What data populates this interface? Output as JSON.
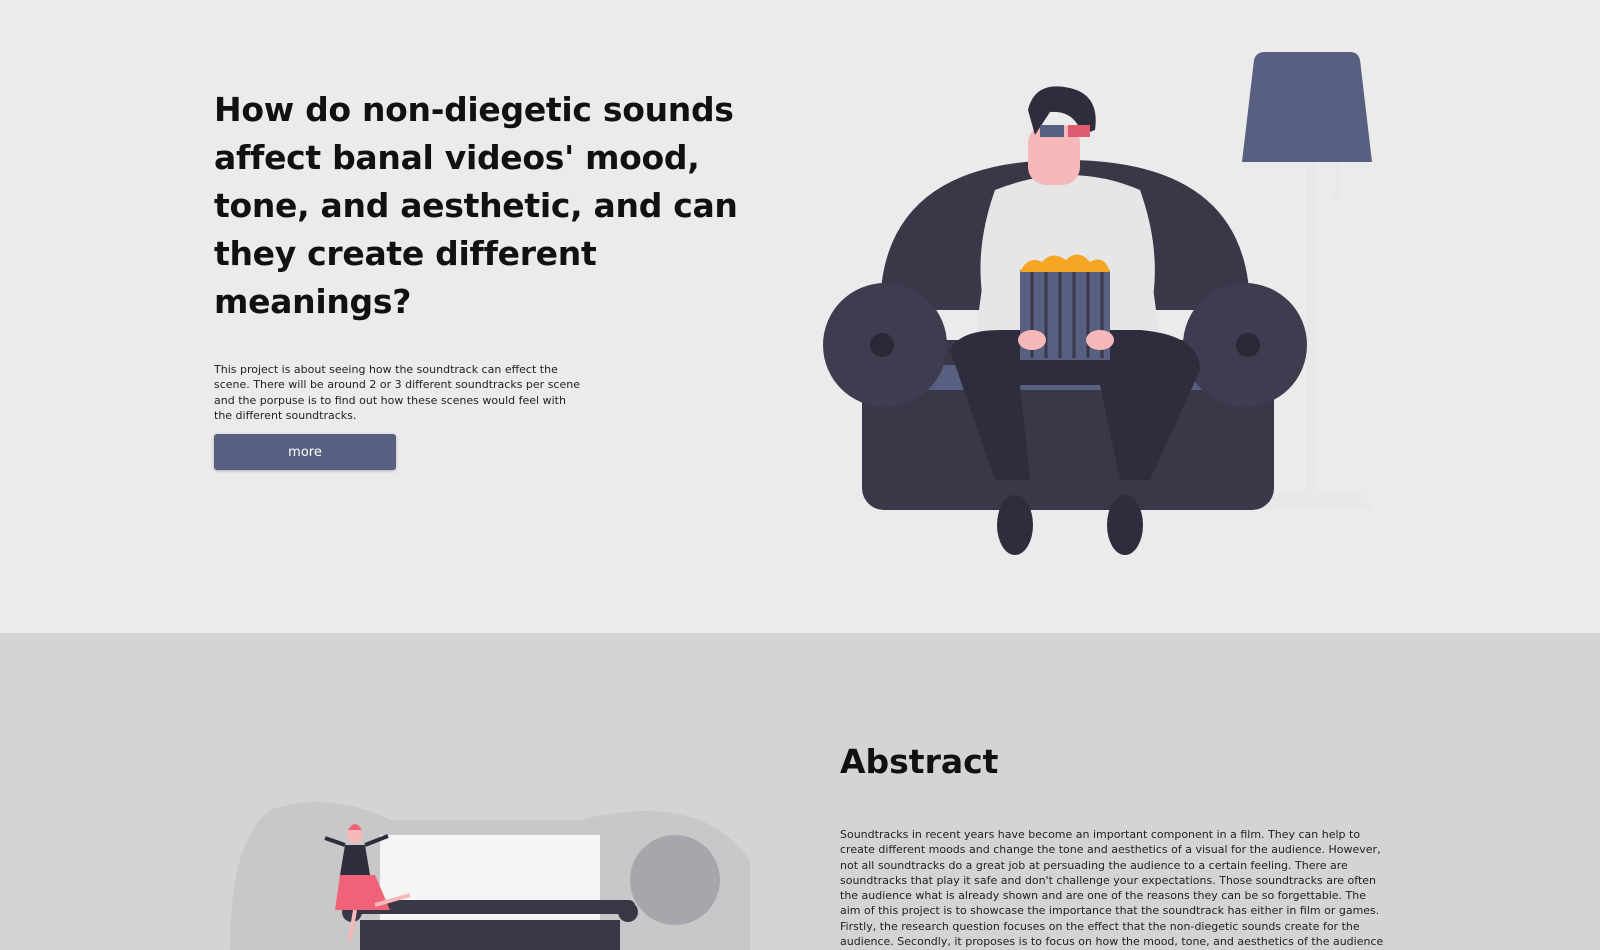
{
  "hero": {
    "title": "How do non-diegetic sounds affect banal videos' mood, tone, and aesthetic, and can they create different meanings?",
    "description": "This project is about seeing how the soundtrack can effect the scene. There will be around 2 or 3 different soundtracks per scene and the porpuse is to find out how these scenes would feel with the different soundtracks.",
    "button_label": "more",
    "illustration": "person-on-armchair-with-popcorn-and-3d-glasses"
  },
  "abstract": {
    "title": "Abstract",
    "text": "Soundtracks in recent years have become an important component in a film. They can help to create different moods and change the tone and aesthetics of a visual for the audience. However, not all soundtracks do a great job at persuading the audience to a certain feeling. There are soundtracks that play it safe and don't challenge your expectations. Those soundtracks are often the audience what is already shown and are one of the reasons they can be so forgettable. The aim of this project is to showcase the importance that the soundtrack has either in film or games. Firstly, the research question focuses on the effect that the non-diegetic sounds create for the audience. Secondly, it proposes is to focus on how the mood, tone, and aesthetics of the audience",
    "illustration": "woman-dancing-beside-typewriter"
  },
  "colors": {
    "hero_bg": "#ebebeb",
    "abstract_bg": "#d4d4d4",
    "accent": "#576080",
    "chair": "#3a3748",
    "popcorn": "#f5a623",
    "glasses_red": "#e05a72",
    "dress": "#f06277"
  }
}
